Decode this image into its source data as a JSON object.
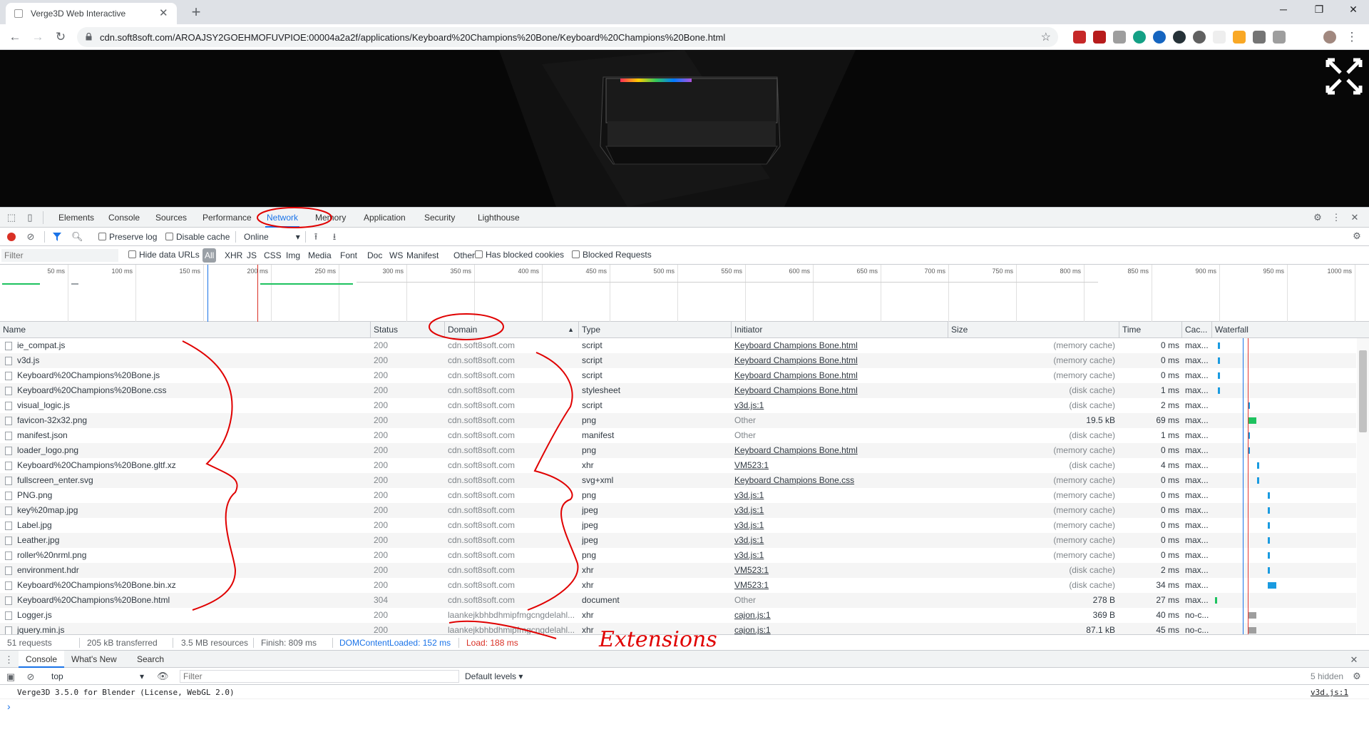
{
  "browser": {
    "tab_title": "Verge3D Web Interactive",
    "new_tab": "+",
    "url": "cdn.soft8soft.com/AROAJSY2GOEHMOFUVPIOE:00004a2a2f/applications/Keyboard%20Champions%20Bone/Keyboard%20Champions%20Bone.html"
  },
  "devtools": {
    "tabs": [
      "Elements",
      "Console",
      "Sources",
      "Performance",
      "Network",
      "Memory",
      "Application",
      "Security",
      "Lighthouse"
    ],
    "active_tab": "Network",
    "preserve_log": "Preserve log",
    "disable_cache": "Disable cache",
    "throttle": "Online",
    "filter_placeholder": "Filter",
    "hide_data_urls": "Hide data URLs",
    "type_filters": [
      "All",
      "XHR",
      "JS",
      "CSS",
      "Img",
      "Media",
      "Font",
      "Doc",
      "WS",
      "Manifest",
      "Other"
    ],
    "has_blocked_cookies": "Has blocked cookies",
    "blocked_requests": "Blocked Requests",
    "timeline_ticks": [
      "50 ms",
      "100 ms",
      "150 ms",
      "200 ms",
      "250 ms",
      "300 ms",
      "350 ms",
      "400 ms",
      "450 ms",
      "500 ms",
      "550 ms",
      "600 ms",
      "650 ms",
      "700 ms",
      "750 ms",
      "800 ms",
      "850 ms",
      "900 ms",
      "950 ms",
      "1000 ms"
    ],
    "columns": [
      "Name",
      "Status",
      "Domain",
      "Type",
      "Initiator",
      "Size",
      "Time",
      "Cac...",
      "Waterfall"
    ],
    "rows": [
      {
        "name": "ie_compat.js",
        "status": "200",
        "domain": "cdn.soft8soft.com",
        "type": "script",
        "initiator": "Keyboard Champions Bone.html",
        "init_link": true,
        "size": "(memory cache)",
        "time": "0 ms",
        "cache": "max...",
        "wf": 0.03,
        "wfc": "#1a9be0"
      },
      {
        "name": "v3d.js",
        "status": "200",
        "domain": "cdn.soft8soft.com",
        "type": "script",
        "initiator": "Keyboard Champions Bone.html",
        "init_link": true,
        "size": "(memory cache)",
        "time": "0 ms",
        "cache": "max...",
        "wf": 0.03,
        "wfc": "#1a9be0"
      },
      {
        "name": "Keyboard%20Champions%20Bone.js",
        "status": "200",
        "domain": "cdn.soft8soft.com",
        "type": "script",
        "initiator": "Keyboard Champions Bone.html",
        "init_link": true,
        "size": "(memory cache)",
        "time": "0 ms",
        "cache": "max...",
        "wf": 0.03,
        "wfc": "#1a9be0"
      },
      {
        "name": "Keyboard%20Champions%20Bone.css",
        "status": "200",
        "domain": "cdn.soft8soft.com",
        "type": "stylesheet",
        "initiator": "Keyboard Champions Bone.html",
        "init_link": true,
        "size": "(disk cache)",
        "time": "1 ms",
        "cache": "max...",
        "wf": 0.03,
        "wfc": "#1a9be0"
      },
      {
        "name": "visual_logic.js",
        "status": "200",
        "domain": "cdn.soft8soft.com",
        "type": "script",
        "initiator": "v3d.js:1",
        "init_link": true,
        "size": "(disk cache)",
        "time": "2 ms",
        "cache": "max...",
        "wf": 0.23,
        "wfc": "#1a9be0"
      },
      {
        "name": "favicon-32x32.png",
        "status": "200",
        "domain": "cdn.soft8soft.com",
        "type": "png",
        "initiator": "Other",
        "init_link": false,
        "size": "19.5 kB",
        "time": "69 ms",
        "cache": "max...",
        "wf": 0.23,
        "wfc": "#1ec25f",
        "wide": true
      },
      {
        "name": "manifest.json",
        "status": "200",
        "domain": "cdn.soft8soft.com",
        "type": "manifest",
        "initiator": "Other",
        "init_link": false,
        "size": "(disk cache)",
        "time": "1 ms",
        "cache": "max...",
        "wf": 0.23,
        "wfc": "#1a9be0"
      },
      {
        "name": "loader_logo.png",
        "status": "200",
        "domain": "cdn.soft8soft.com",
        "type": "png",
        "initiator": "Keyboard Champions Bone.html",
        "init_link": true,
        "size": "(memory cache)",
        "time": "0 ms",
        "cache": "max...",
        "wf": 0.23,
        "wfc": "#1a9be0"
      },
      {
        "name": "Keyboard%20Champions%20Bone.gltf.xz",
        "status": "200",
        "domain": "cdn.soft8soft.com",
        "type": "xhr",
        "initiator": "VM523:1",
        "init_link": true,
        "size": "(disk cache)",
        "time": "4 ms",
        "cache": "max...",
        "wf": 0.29,
        "wfc": "#1a9be0"
      },
      {
        "name": "fullscreen_enter.svg",
        "status": "200",
        "domain": "cdn.soft8soft.com",
        "type": "svg+xml",
        "initiator": "Keyboard Champions Bone.css",
        "init_link": true,
        "size": "(memory cache)",
        "time": "0 ms",
        "cache": "max...",
        "wf": 0.29,
        "wfc": "#1a9be0"
      },
      {
        "name": "PNG.png",
        "status": "200",
        "domain": "cdn.soft8soft.com",
        "type": "png",
        "initiator": "v3d.js:1",
        "init_link": true,
        "size": "(memory cache)",
        "time": "0 ms",
        "cache": "max...",
        "wf": 0.36,
        "wfc": "#1a9be0"
      },
      {
        "name": "key%20map.jpg",
        "status": "200",
        "domain": "cdn.soft8soft.com",
        "type": "jpeg",
        "initiator": "v3d.js:1",
        "init_link": true,
        "size": "(memory cache)",
        "time": "0 ms",
        "cache": "max...",
        "wf": 0.36,
        "wfc": "#1a9be0"
      },
      {
        "name": "Label.jpg",
        "status": "200",
        "domain": "cdn.soft8soft.com",
        "type": "jpeg",
        "initiator": "v3d.js:1",
        "init_link": true,
        "size": "(memory cache)",
        "time": "0 ms",
        "cache": "max...",
        "wf": 0.36,
        "wfc": "#1a9be0"
      },
      {
        "name": "Leather.jpg",
        "status": "200",
        "domain": "cdn.soft8soft.com",
        "type": "jpeg",
        "initiator": "v3d.js:1",
        "init_link": true,
        "size": "(memory cache)",
        "time": "0 ms",
        "cache": "max...",
        "wf": 0.36,
        "wfc": "#1a9be0"
      },
      {
        "name": "roller%20nrml.png",
        "status": "200",
        "domain": "cdn.soft8soft.com",
        "type": "png",
        "initiator": "v3d.js:1",
        "init_link": true,
        "size": "(memory cache)",
        "time": "0 ms",
        "cache": "max...",
        "wf": 0.36,
        "wfc": "#1a9be0"
      },
      {
        "name": "environment.hdr",
        "status": "200",
        "domain": "cdn.soft8soft.com",
        "type": "xhr",
        "initiator": "VM523:1",
        "init_link": true,
        "size": "(disk cache)",
        "time": "2 ms",
        "cache": "max...",
        "wf": 0.36,
        "wfc": "#1a9be0"
      },
      {
        "name": "Keyboard%20Champions%20Bone.bin.xz",
        "status": "200",
        "domain": "cdn.soft8soft.com",
        "type": "xhr",
        "initiator": "VM523:1",
        "init_link": true,
        "size": "(disk cache)",
        "time": "34 ms",
        "cache": "max...",
        "wf": 0.36,
        "wfc": "#1a9be0",
        "wide": true
      },
      {
        "name": "Keyboard%20Champions%20Bone.html",
        "status": "304",
        "domain": "cdn.soft8soft.com",
        "type": "document",
        "initiator": "Other",
        "init_link": false,
        "size": "278 B",
        "time": "27 ms",
        "cache": "max...",
        "wf": 0.01,
        "wfc": "#1ec25f"
      },
      {
        "name": "Logger.js",
        "status": "200",
        "domain": "laankejkbhbdhmipfmgcngdelahl...",
        "type": "xhr",
        "initiator": "cajon.js:1",
        "init_link": true,
        "size": "369 B",
        "time": "40 ms",
        "cache": "no-c...",
        "wf": 0.23,
        "wfc": "#9e9e9e",
        "wide": true
      },
      {
        "name": "jquery.min.js",
        "status": "200",
        "domain": "laankejkbhbdhmipfmgcngdelahl...",
        "type": "xhr",
        "initiator": "cajon.js:1",
        "init_link": true,
        "size": "87.1 kB",
        "time": "45 ms",
        "cache": "no-c...",
        "wf": 0.23,
        "wfc": "#9e9e9e",
        "wide": true
      }
    ],
    "status": {
      "requests": "51 requests",
      "transferred": "205 kB transferred",
      "resources": "3.5 MB resources",
      "finish": "Finish: 809 ms",
      "dcl": "DOMContentLoaded: 152 ms",
      "load": "Load: 188 ms"
    },
    "drawer": {
      "tabs": [
        "Console",
        "What's New",
        "Search"
      ],
      "context": "top",
      "filter_placeholder": "Filter",
      "levels": "Default levels ▾",
      "hidden": "5 hidden",
      "log": "Verge3D 3.5.0 for Blender (License, WebGL 2.0)",
      "log_src": "v3d.js:1",
      "prompt": "›"
    }
  },
  "annotation": {
    "text": "Extensions",
    "color": "#e00000"
  },
  "colors": {
    "accent": "#1a73e8",
    "dcl": "#1a73e8",
    "load": "#d93025",
    "record": "#d93025"
  }
}
